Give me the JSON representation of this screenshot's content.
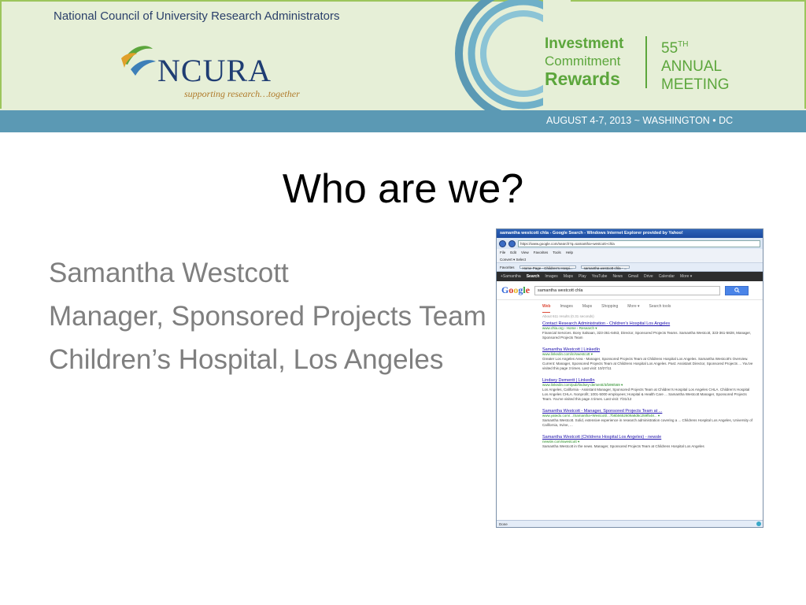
{
  "banner": {
    "org_name": "National Council of University Research Administrators",
    "logo_text": "NCURA",
    "tagline": "supporting research…together",
    "theme_line1": "Investment",
    "theme_line2": "Commitment",
    "theme_line3": "Rewards",
    "annual_number": "55",
    "annual_suffix": "TH",
    "annual_line2": "ANNUAL",
    "annual_line3": "MEETING",
    "dates": "AUGUST 4-7, 2013  ~  WASHINGTON • DC",
    "colors": {
      "green": "#5ca63c",
      "navy": "#1f3d73",
      "strip": "#5b99b4",
      "background": "#e6efd7"
    }
  },
  "slide": {
    "title": "Who are we?",
    "bullets": [
      "Samantha Westcott",
      "Manager, Sponsored Projects Team",
      "Children’s Hospital, Los Angeles"
    ]
  },
  "screenshot": {
    "window_title": "samantha westcott chla - Google Search - Windows Internet Explorer provided by Yahoo!",
    "url": "https://www.google.com/search?q=samantha+westcott+chla",
    "menu": [
      "File",
      "Edit",
      "View",
      "Favorites",
      "Tools",
      "Help"
    ],
    "convert_row": "Convert ▾   Select",
    "favorites": "Favorites",
    "tab1": "Home Page - Children's Hospi...",
    "tab2": "samantha westcott chla - ...",
    "google_bar": [
      "+Samantha",
      "Search",
      "Images",
      "Maps",
      "Play",
      "YouTube",
      "News",
      "Gmail",
      "Drive",
      "Calendar",
      "More ▾"
    ],
    "search_query": "samantha westcott chla",
    "search_tabs": [
      "Web",
      "Images",
      "Maps",
      "Shopping",
      "More ▾",
      "Search tools"
    ],
    "stats": "About 611 results (0.31 seconds)",
    "results": [
      {
        "title": "Contact Research Administration - Children's Hospital Los Angeles",
        "url": "www.chla.org › Home › Research ▾",
        "snippet": "Financial Services. Bony Salsaan, 323-361-6463, Director, Sponsored Projects Teams. Samantha Westcott, 323-361-5828, Manager, Sponsored Projects Team"
      },
      {
        "title": "Samantha Westcott | LinkedIn",
        "url": "www.linkedin.com/in/swestcott ▾",
        "snippet": "Greater Los Angeles Area - Manager, Sponsored Projects Team at Childrens Hospital Los Angeles. Samantha Westcott's Overview. Current: Manager, Sponsored Projects Team at Childrens Hospital Los Angeles. Past: Assistant Director, Sponsored Projects ... You've visited this page 3 times. Last visit: 10/27/11"
      },
      {
        "title": "Lindsey Dementt | LinkedIn",
        "url": "www.linkedin.com/pub/lindsey-dementt/3/b99/569 ▾",
        "snippet": "Los Angeles, California - Assistant Manager, Sponsored Projects Team at Children's Hospital Los Angeles CHLA. Children's Hospital Los Angeles CHLA. Nonprofit; 1001-5000 employees; Hospital & Health Care ... Samantha Westcott Manager, Sponsored Projects Team. You've visited this page 4 times. Last visit: 7/31/12"
      },
      {
        "title": "Samantha Westcott - Manager, Sponsored Projects Team at ...",
        "url": "www.yatedo.com/.../Samantha+Westcott/...7b6b5652609a8d6c259f548... ▾",
        "snippet": "Samantha Westcott. Solid, extensive experience in research administration covering a ... Childrens Hospital Los Angeles, University of California, Irvine, ..."
      },
      {
        "title": "Samantha Westcott (Childrens Hospital Los Angeles) - newsle",
        "url": "newsle.com/swestcott ▾",
        "snippet": "Samantha Westcott in the news. Manager, Sponsored Projects Team at Childrens Hospital Los Angeles"
      }
    ],
    "status": "Done"
  }
}
